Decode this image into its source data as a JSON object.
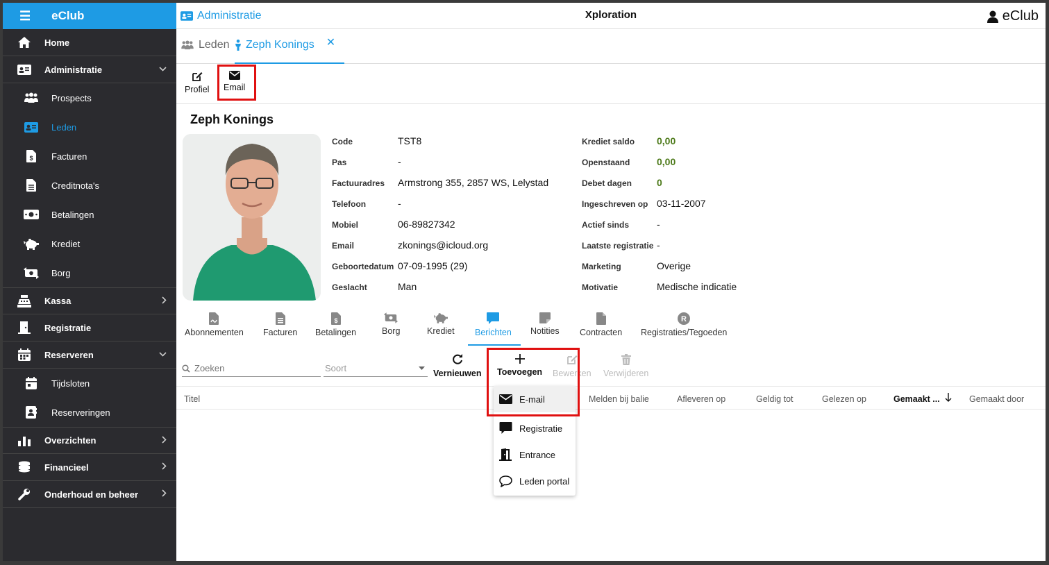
{
  "sidebar": {
    "brand": "eClub",
    "items": [
      {
        "label": "Home"
      },
      {
        "label": "Administratie"
      },
      {
        "label": "Prospects"
      },
      {
        "label": "Leden"
      },
      {
        "label": "Facturen"
      },
      {
        "label": "Creditnota's"
      },
      {
        "label": "Betalingen"
      },
      {
        "label": "Krediet"
      },
      {
        "label": "Borg"
      },
      {
        "label": "Kassa"
      },
      {
        "label": "Registratie"
      },
      {
        "label": "Reserveren"
      },
      {
        "label": "Tijdsloten"
      },
      {
        "label": "Reserveringen"
      },
      {
        "label": "Overzichten"
      },
      {
        "label": "Financieel"
      },
      {
        "label": "Onderhoud en beheer"
      }
    ]
  },
  "header": {
    "section": "Administratie",
    "title": "Xploration",
    "user": "eClub"
  },
  "tabs": {
    "leden": "Leden",
    "member": "Zeph Konings",
    "close": "✕"
  },
  "toolbar": {
    "profiel": "Profiel",
    "email": "Email"
  },
  "member": {
    "name": "Zeph Konings",
    "left": [
      {
        "label": "Code",
        "value": "TST8"
      },
      {
        "label": "Pas",
        "value": "-"
      },
      {
        "label": "Factuuradres",
        "value": "Armstrong 355, 2857 WS, Lelystad"
      },
      {
        "label": "Telefoon",
        "value": "-"
      },
      {
        "label": "Mobiel",
        "value": "06-89827342"
      },
      {
        "label": "Email",
        "value": "zkonings@icloud.org"
      },
      {
        "label": "Geboortedatum",
        "value": "07-09-1995 (29)"
      },
      {
        "label": "Geslacht",
        "value": "Man"
      }
    ],
    "right": [
      {
        "label": "Krediet saldo",
        "value": "0,00"
      },
      {
        "label": "Openstaand",
        "value": "0,00"
      },
      {
        "label": "Debet dagen",
        "value": "0"
      },
      {
        "label": "Ingeschreven op",
        "value": "03-11-2007"
      },
      {
        "label": "Actief sinds",
        "value": "-"
      },
      {
        "label": "Laatste registratie",
        "value": "-"
      },
      {
        "label": "Marketing",
        "value": "Overige"
      },
      {
        "label": "Motivatie",
        "value": "Medische indicatie"
      }
    ]
  },
  "section_tabs": [
    "Abonnementen",
    "Facturen",
    "Betalingen",
    "Borg",
    "Krediet",
    "Berichten",
    "Notities",
    "Contracten",
    "Registraties/Tegoeden"
  ],
  "filters": {
    "search_placeholder": "Zoeken",
    "soort_placeholder": "Soort"
  },
  "actions": {
    "vernieuwen": "Vernieuwen",
    "toevoegen": "Toevoegen",
    "bewerken": "Bewerken",
    "verwijderen": "Verwijderen"
  },
  "table": {
    "headers": [
      "Titel",
      "Melden bij balie",
      "Afleveren op",
      "Geldig tot",
      "Gelezen op",
      "Gemaakt ...",
      "Gemaakt door"
    ]
  },
  "dropdown": {
    "items": [
      "E-mail",
      "Registratie",
      "Entrance",
      "Leden portal"
    ]
  },
  "colors": {
    "accent": "#1e9be4",
    "sidebar": "#2b2b2f",
    "highlight": "#e01010",
    "green": "#4d7a1a"
  }
}
